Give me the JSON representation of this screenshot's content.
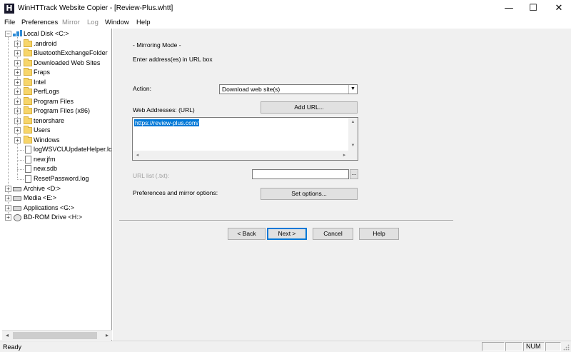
{
  "window": {
    "title": "WinHTTrack Website Copier - [Review-Plus.whtt]",
    "app_icon_letter": "H",
    "minimize_glyph": "—",
    "maximize_glyph": "☐",
    "close_glyph": "✕"
  },
  "menu": {
    "items": [
      {
        "label": "File",
        "enabled": true
      },
      {
        "label": "Preferences",
        "enabled": true
      },
      {
        "label": "Mirror",
        "enabled": false
      },
      {
        "label": "Log",
        "enabled": false
      },
      {
        "label": "Window",
        "enabled": true
      },
      {
        "label": "Help",
        "enabled": true
      }
    ]
  },
  "tree": {
    "root": {
      "label": "Local Disk <C:>",
      "expander": "−"
    },
    "children": [
      {
        "label": ".android",
        "type": "folder",
        "expander": "+"
      },
      {
        "label": "BluetoothExchangeFolder",
        "type": "folder",
        "expander": "+"
      },
      {
        "label": "Downloaded Web Sites",
        "type": "folder",
        "expander": "+"
      },
      {
        "label": "Fraps",
        "type": "folder",
        "expander": "+"
      },
      {
        "label": "Intel",
        "type": "folder",
        "expander": "+"
      },
      {
        "label": "PerfLogs",
        "type": "folder",
        "expander": "+"
      },
      {
        "label": "Program Files",
        "type": "folder",
        "expander": "+"
      },
      {
        "label": "Program Files (x86)",
        "type": "folder",
        "expander": "+"
      },
      {
        "label": "tenorshare",
        "type": "folder",
        "expander": "+"
      },
      {
        "label": "Users",
        "type": "folder",
        "expander": "+"
      },
      {
        "label": "Windows",
        "type": "folder",
        "expander": "+"
      },
      {
        "label": "logWSVCUUpdateHelper.lc",
        "type": "file",
        "expander": ""
      },
      {
        "label": "new.jfm",
        "type": "file",
        "expander": ""
      },
      {
        "label": "new.sdb",
        "type": "file",
        "expander": ""
      },
      {
        "label": "ResetPassword.log",
        "type": "file",
        "expander": ""
      }
    ],
    "drives": [
      {
        "label": "Archive <D:>",
        "type": "drive",
        "expander": "+"
      },
      {
        "label": "Media <E:>",
        "type": "drive",
        "expander": "+"
      },
      {
        "label": "Applications <G:>",
        "type": "drive",
        "expander": "+"
      },
      {
        "label": "BD-ROM Drive <H:>",
        "type": "cd",
        "expander": "+"
      }
    ],
    "scroll_left": "◂",
    "scroll_right": "▸"
  },
  "wizard": {
    "mode_title": "- Mirroring Mode -",
    "instructions": "Enter address(es) in URL box",
    "action_label": "Action:",
    "action_value": "Download web site(s)",
    "web_addresses_label": "Web Addresses: (URL)",
    "add_url_button": "Add URL...",
    "url_text": "https://review-plus.com/",
    "url_list_label": "URL list (.txt):",
    "url_list_value": "",
    "browse_button": "...",
    "preferences_label": "Preferences and mirror options:",
    "set_options_button": "Set options...",
    "back_button": "< Back",
    "next_button": "Next >",
    "cancel_button": "Cancel",
    "help_button": "Help"
  },
  "status": {
    "text": "Ready",
    "num": "NUM"
  }
}
